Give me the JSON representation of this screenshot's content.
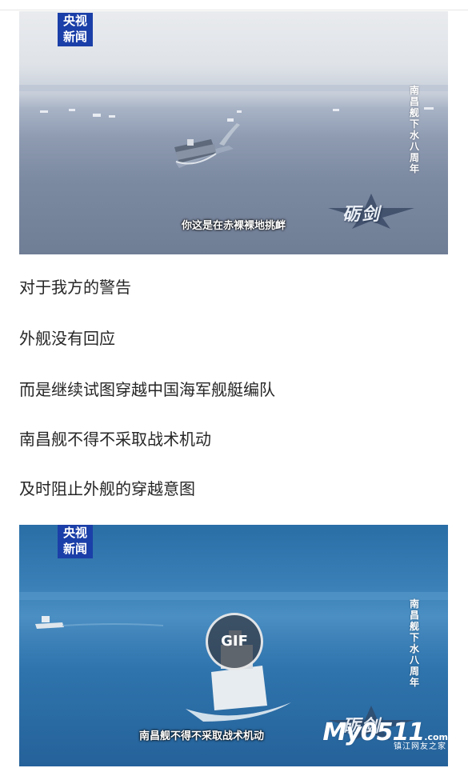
{
  "frame1": {
    "logo": [
      "央视",
      "新闻"
    ],
    "vertical_caption": "南昌舰下水八周年",
    "subtitle": "你这是在赤裸裸地挑衅",
    "brand": "砺剑"
  },
  "paragraphs": [
    "对于我方的警告",
    "外舰没有回应",
    "而是继续试图穿越中国海军舰艇编队",
    "南昌舰不得不采取战术机动",
    "及时阻止外舰的穿越意图"
  ],
  "frame2": {
    "logo": [
      "央视",
      "新闻"
    ],
    "vertical_caption": "南昌舰下水八周年",
    "subtitle": "南昌舰不得不采取战术机动",
    "brand": "砺剑",
    "gif_badge": "GIF"
  },
  "watermark": {
    "main": "My0511",
    "suffix": ".com",
    "sub": "镇江网友之家"
  }
}
